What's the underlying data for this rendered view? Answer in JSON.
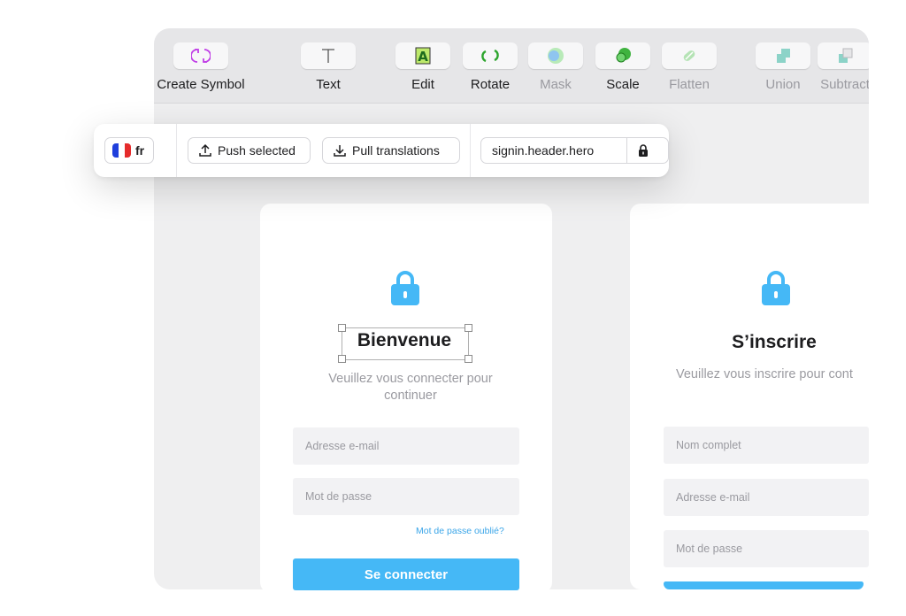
{
  "toolbar": {
    "items": [
      {
        "label": "Create Symbol",
        "icon": "create-symbol-icon",
        "enabled": true
      },
      {
        "label": "Text",
        "icon": "text-icon",
        "enabled": true
      },
      {
        "label": "Edit",
        "icon": "edit-icon",
        "enabled": true
      },
      {
        "label": "Rotate",
        "icon": "rotate-icon",
        "enabled": true
      },
      {
        "label": "Mask",
        "icon": "mask-icon",
        "enabled": false
      },
      {
        "label": "Scale",
        "icon": "scale-icon",
        "enabled": true
      },
      {
        "label": "Flatten",
        "icon": "flatten-icon",
        "enabled": false
      },
      {
        "label": "Union",
        "icon": "union-icon",
        "enabled": false
      },
      {
        "label": "Subtract",
        "icon": "subtract-icon",
        "enabled": false
      }
    ]
  },
  "translation_bar": {
    "language_code": "fr",
    "flag_colors": [
      "#1f3fdc",
      "#ffffff",
      "#e52b2b"
    ],
    "push_label": "Push selected",
    "pull_label": "Pull translations",
    "key_value": "signin.header.hero",
    "key_locked": true
  },
  "artboards": {
    "signin": {
      "title": "Bienvenue",
      "subtitle": "Veuillez vous connecter pour continuer",
      "email_placeholder": "Adresse e-mail",
      "password_placeholder": "Mot de passe",
      "forgot_link": "Mot de passe oublié?",
      "submit_label": "Se connecter"
    },
    "signup": {
      "title": "S’inscrire",
      "subtitle": "Veuillez vous inscrire pour cont",
      "name_placeholder": "Nom complet",
      "email_placeholder": "Adresse e-mail",
      "password_placeholder": "Mot de passe"
    }
  },
  "colors": {
    "accent": "#45b8f6",
    "link": "#3aa5e8",
    "lock": "#45b8f6"
  }
}
